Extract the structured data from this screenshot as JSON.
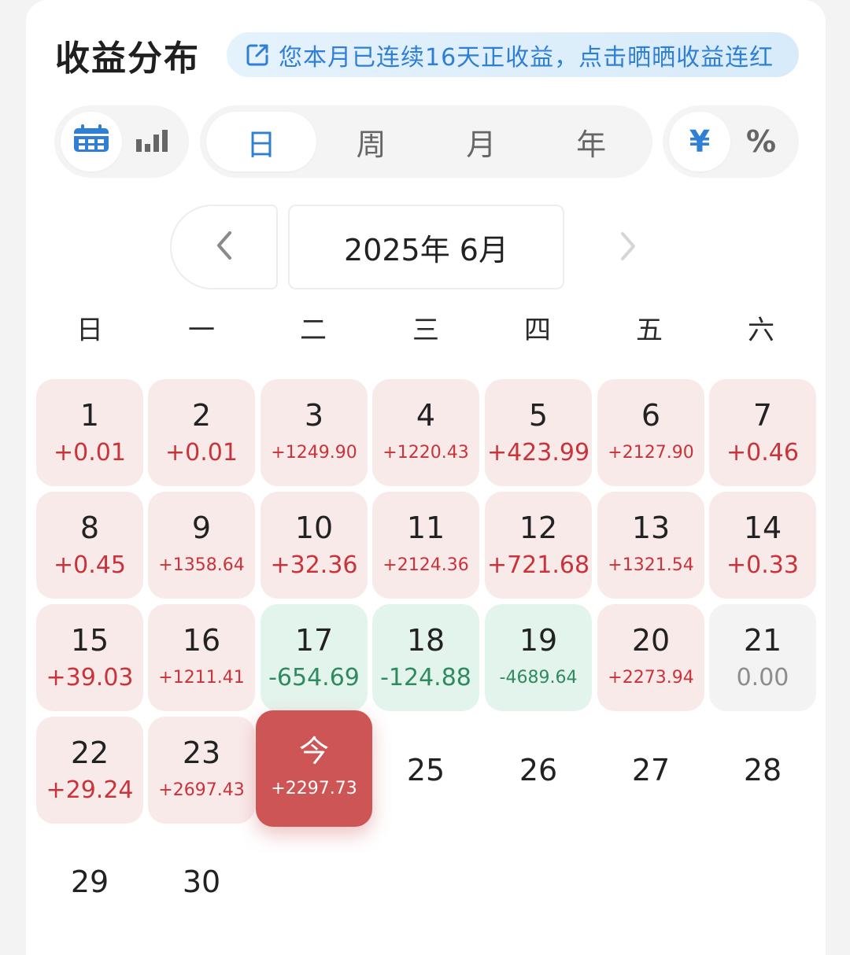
{
  "header": {
    "title": "收益分布",
    "banner_text": "您本月已连续16天正收益，点击晒晒收益连红"
  },
  "view_toggle": {
    "options": [
      {
        "icon": "calendar-icon",
        "active": true
      },
      {
        "icon": "bar-chart-icon",
        "active": false
      }
    ]
  },
  "period_tabs": [
    {
      "label": "日",
      "active": true
    },
    {
      "label": "周",
      "active": false
    },
    {
      "label": "月",
      "active": false
    },
    {
      "label": "年",
      "active": false
    }
  ],
  "unit_toggle": [
    {
      "label": "¥",
      "active": true
    },
    {
      "label": "%",
      "active": false
    }
  ],
  "month_nav": {
    "current": "2025年 6月"
  },
  "weekdays": [
    "日",
    "一",
    "二",
    "三",
    "四",
    "五",
    "六"
  ],
  "colors": {
    "accent": "#2f7fd6",
    "positive": "#c9333a",
    "negative": "#2f8a5f",
    "today": "#cd5555"
  },
  "days": [
    {
      "day": "1",
      "value": "+0.01",
      "type": "pos"
    },
    {
      "day": "2",
      "value": "+0.01",
      "type": "pos"
    },
    {
      "day": "3",
      "value": "+1249.90",
      "type": "pos"
    },
    {
      "day": "4",
      "value": "+1220.43",
      "type": "pos"
    },
    {
      "day": "5",
      "value": "+423.99",
      "type": "pos"
    },
    {
      "day": "6",
      "value": "+2127.90",
      "type": "pos"
    },
    {
      "day": "7",
      "value": "+0.46",
      "type": "pos"
    },
    {
      "day": "8",
      "value": "+0.45",
      "type": "pos"
    },
    {
      "day": "9",
      "value": "+1358.64",
      "type": "pos"
    },
    {
      "day": "10",
      "value": "+32.36",
      "type": "pos"
    },
    {
      "day": "11",
      "value": "+2124.36",
      "type": "pos"
    },
    {
      "day": "12",
      "value": "+721.68",
      "type": "pos"
    },
    {
      "day": "13",
      "value": "+1321.54",
      "type": "pos"
    },
    {
      "day": "14",
      "value": "+0.33",
      "type": "pos"
    },
    {
      "day": "15",
      "value": "+39.03",
      "type": "pos"
    },
    {
      "day": "16",
      "value": "+1211.41",
      "type": "pos"
    },
    {
      "day": "17",
      "value": "-654.69",
      "type": "neg"
    },
    {
      "day": "18",
      "value": "-124.88",
      "type": "neg"
    },
    {
      "day": "19",
      "value": "-4689.64",
      "type": "neg"
    },
    {
      "day": "20",
      "value": "+2273.94",
      "type": "pos"
    },
    {
      "day": "21",
      "value": "0.00",
      "type": "zero"
    },
    {
      "day": "22",
      "value": "+29.24",
      "type": "pos"
    },
    {
      "day": "23",
      "value": "+2697.43",
      "type": "pos"
    },
    {
      "day": "今",
      "value": "+2297.73",
      "type": "today"
    },
    {
      "day": "25",
      "value": "",
      "type": "empty"
    },
    {
      "day": "26",
      "value": "",
      "type": "empty"
    },
    {
      "day": "27",
      "value": "",
      "type": "empty"
    },
    {
      "day": "28",
      "value": "",
      "type": "empty"
    },
    {
      "day": "29",
      "value": "",
      "type": "empty"
    },
    {
      "day": "30",
      "value": "",
      "type": "empty"
    }
  ]
}
